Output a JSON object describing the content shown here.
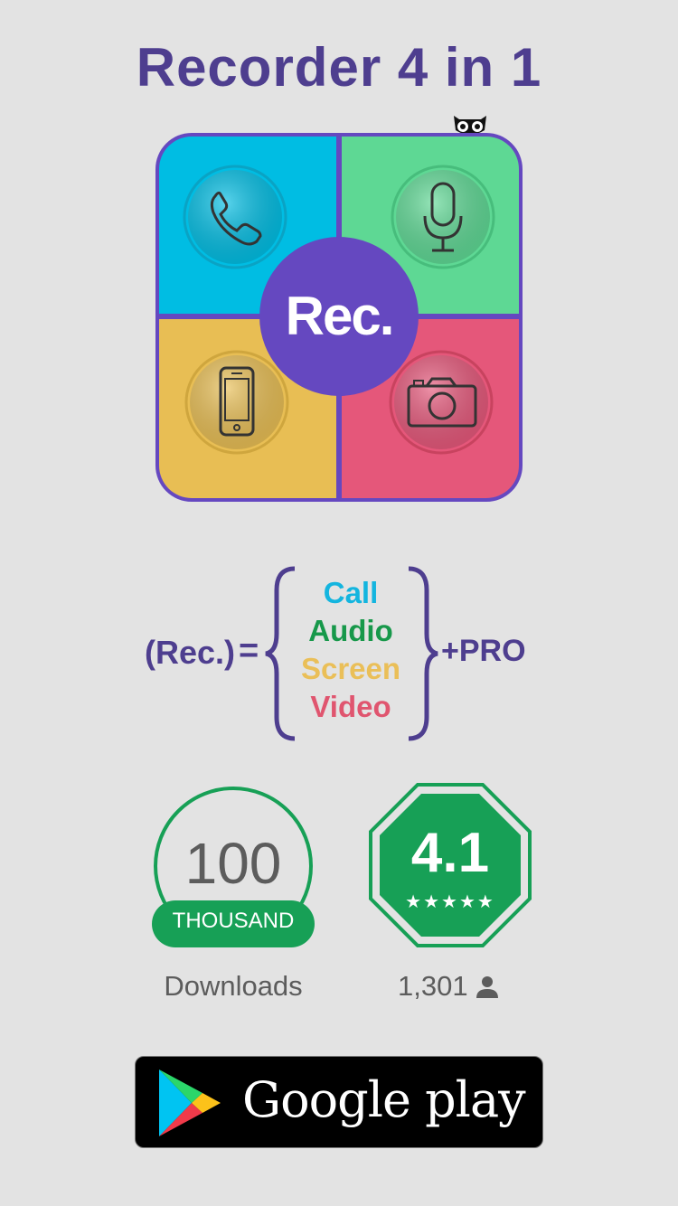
{
  "title": "Recorder 4 in 1",
  "app_icon": {
    "center_label": "Rec.",
    "quadrants": [
      {
        "name": "call",
        "color": "#00bde3",
        "icon": "phone-icon"
      },
      {
        "name": "audio",
        "color": "#5ed894",
        "icon": "microphone-icon"
      },
      {
        "name": "screen",
        "color": "#e8be54",
        "icon": "smartphone-icon"
      },
      {
        "name": "video",
        "color": "#e5577a",
        "icon": "camera-icon"
      }
    ],
    "frame_color": "#6548c0"
  },
  "formula": {
    "left": "(Rec.)",
    "equals": "=",
    "items": [
      "Call",
      "Audio",
      "Screen",
      "Video"
    ],
    "right": "+PRO"
  },
  "downloads": {
    "number": "100",
    "unit": "THOUSAND",
    "label": "Downloads"
  },
  "rating": {
    "value": "4.1",
    "stars": "★★★★★",
    "review_count": "1,301"
  },
  "store_button": {
    "label": "Google play"
  },
  "colors": {
    "accent_purple": "#4e3e8f",
    "badge_green": "#17a056"
  }
}
